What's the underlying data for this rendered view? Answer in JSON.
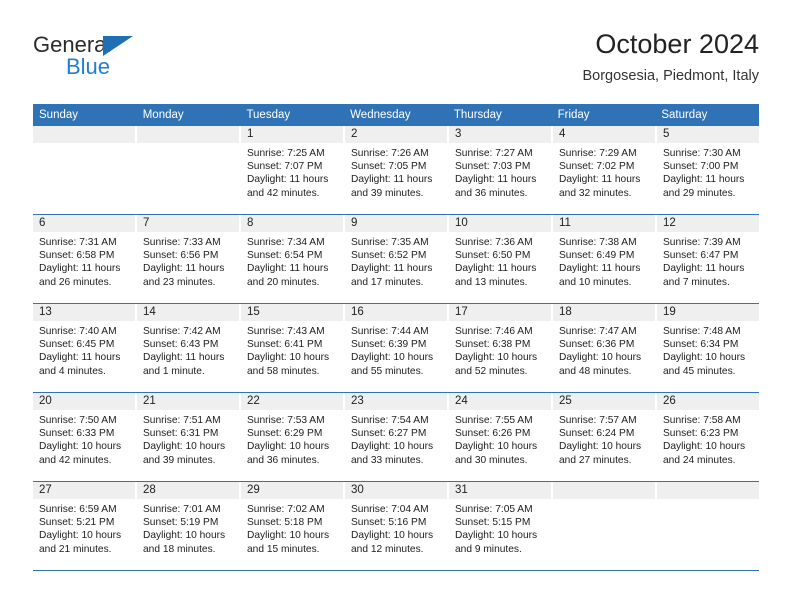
{
  "brand": {
    "name_top": "General",
    "name_bottom": "Blue",
    "triangle_color": "#1f6fb5",
    "blue_color": "#1f7fd0"
  },
  "header": {
    "title": "October 2024",
    "subtitle": "Borgosesia, Piedmont, Italy"
  },
  "theme": {
    "header_blue": "#2f73b6",
    "daynum_strip": "#efefef",
    "text": "#222222"
  },
  "weekdays": [
    "Sunday",
    "Monday",
    "Tuesday",
    "Wednesday",
    "Thursday",
    "Friday",
    "Saturday"
  ],
  "weeks": [
    [
      {
        "day": "",
        "sunrise": "",
        "sunset": "",
        "daylight1": "",
        "daylight2": "",
        "empty": true
      },
      {
        "day": "",
        "sunrise": "",
        "sunset": "",
        "daylight1": "",
        "daylight2": "",
        "empty": true
      },
      {
        "day": "1",
        "sunrise": "Sunrise: 7:25 AM",
        "sunset": "Sunset: 7:07 PM",
        "daylight1": "Daylight: 11 hours",
        "daylight2": "and 42 minutes."
      },
      {
        "day": "2",
        "sunrise": "Sunrise: 7:26 AM",
        "sunset": "Sunset: 7:05 PM",
        "daylight1": "Daylight: 11 hours",
        "daylight2": "and 39 minutes."
      },
      {
        "day": "3",
        "sunrise": "Sunrise: 7:27 AM",
        "sunset": "Sunset: 7:03 PM",
        "daylight1": "Daylight: 11 hours",
        "daylight2": "and 36 minutes."
      },
      {
        "day": "4",
        "sunrise": "Sunrise: 7:29 AM",
        "sunset": "Sunset: 7:02 PM",
        "daylight1": "Daylight: 11 hours",
        "daylight2": "and 32 minutes."
      },
      {
        "day": "5",
        "sunrise": "Sunrise: 7:30 AM",
        "sunset": "Sunset: 7:00 PM",
        "daylight1": "Daylight: 11 hours",
        "daylight2": "and 29 minutes."
      }
    ],
    [
      {
        "day": "6",
        "sunrise": "Sunrise: 7:31 AM",
        "sunset": "Sunset: 6:58 PM",
        "daylight1": "Daylight: 11 hours",
        "daylight2": "and 26 minutes."
      },
      {
        "day": "7",
        "sunrise": "Sunrise: 7:33 AM",
        "sunset": "Sunset: 6:56 PM",
        "daylight1": "Daylight: 11 hours",
        "daylight2": "and 23 minutes."
      },
      {
        "day": "8",
        "sunrise": "Sunrise: 7:34 AM",
        "sunset": "Sunset: 6:54 PM",
        "daylight1": "Daylight: 11 hours",
        "daylight2": "and 20 minutes."
      },
      {
        "day": "9",
        "sunrise": "Sunrise: 7:35 AM",
        "sunset": "Sunset: 6:52 PM",
        "daylight1": "Daylight: 11 hours",
        "daylight2": "and 17 minutes."
      },
      {
        "day": "10",
        "sunrise": "Sunrise: 7:36 AM",
        "sunset": "Sunset: 6:50 PM",
        "daylight1": "Daylight: 11 hours",
        "daylight2": "and 13 minutes."
      },
      {
        "day": "11",
        "sunrise": "Sunrise: 7:38 AM",
        "sunset": "Sunset: 6:49 PM",
        "daylight1": "Daylight: 11 hours",
        "daylight2": "and 10 minutes."
      },
      {
        "day": "12",
        "sunrise": "Sunrise: 7:39 AM",
        "sunset": "Sunset: 6:47 PM",
        "daylight1": "Daylight: 11 hours",
        "daylight2": "and 7 minutes."
      }
    ],
    [
      {
        "day": "13",
        "sunrise": "Sunrise: 7:40 AM",
        "sunset": "Sunset: 6:45 PM",
        "daylight1": "Daylight: 11 hours",
        "daylight2": "and 4 minutes."
      },
      {
        "day": "14",
        "sunrise": "Sunrise: 7:42 AM",
        "sunset": "Sunset: 6:43 PM",
        "daylight1": "Daylight: 11 hours",
        "daylight2": "and 1 minute."
      },
      {
        "day": "15",
        "sunrise": "Sunrise: 7:43 AM",
        "sunset": "Sunset: 6:41 PM",
        "daylight1": "Daylight: 10 hours",
        "daylight2": "and 58 minutes."
      },
      {
        "day": "16",
        "sunrise": "Sunrise: 7:44 AM",
        "sunset": "Sunset: 6:39 PM",
        "daylight1": "Daylight: 10 hours",
        "daylight2": "and 55 minutes."
      },
      {
        "day": "17",
        "sunrise": "Sunrise: 7:46 AM",
        "sunset": "Sunset: 6:38 PM",
        "daylight1": "Daylight: 10 hours",
        "daylight2": "and 52 minutes."
      },
      {
        "day": "18",
        "sunrise": "Sunrise: 7:47 AM",
        "sunset": "Sunset: 6:36 PM",
        "daylight1": "Daylight: 10 hours",
        "daylight2": "and 48 minutes."
      },
      {
        "day": "19",
        "sunrise": "Sunrise: 7:48 AM",
        "sunset": "Sunset: 6:34 PM",
        "daylight1": "Daylight: 10 hours",
        "daylight2": "and 45 minutes."
      }
    ],
    [
      {
        "day": "20",
        "sunrise": "Sunrise: 7:50 AM",
        "sunset": "Sunset: 6:33 PM",
        "daylight1": "Daylight: 10 hours",
        "daylight2": "and 42 minutes."
      },
      {
        "day": "21",
        "sunrise": "Sunrise: 7:51 AM",
        "sunset": "Sunset: 6:31 PM",
        "daylight1": "Daylight: 10 hours",
        "daylight2": "and 39 minutes."
      },
      {
        "day": "22",
        "sunrise": "Sunrise: 7:53 AM",
        "sunset": "Sunset: 6:29 PM",
        "daylight1": "Daylight: 10 hours",
        "daylight2": "and 36 minutes."
      },
      {
        "day": "23",
        "sunrise": "Sunrise: 7:54 AM",
        "sunset": "Sunset: 6:27 PM",
        "daylight1": "Daylight: 10 hours",
        "daylight2": "and 33 minutes."
      },
      {
        "day": "24",
        "sunrise": "Sunrise: 7:55 AM",
        "sunset": "Sunset: 6:26 PM",
        "daylight1": "Daylight: 10 hours",
        "daylight2": "and 30 minutes."
      },
      {
        "day": "25",
        "sunrise": "Sunrise: 7:57 AM",
        "sunset": "Sunset: 6:24 PM",
        "daylight1": "Daylight: 10 hours",
        "daylight2": "and 27 minutes."
      },
      {
        "day": "26",
        "sunrise": "Sunrise: 7:58 AM",
        "sunset": "Sunset: 6:23 PM",
        "daylight1": "Daylight: 10 hours",
        "daylight2": "and 24 minutes."
      }
    ],
    [
      {
        "day": "27",
        "sunrise": "Sunrise: 6:59 AM",
        "sunset": "Sunset: 5:21 PM",
        "daylight1": "Daylight: 10 hours",
        "daylight2": "and 21 minutes."
      },
      {
        "day": "28",
        "sunrise": "Sunrise: 7:01 AM",
        "sunset": "Sunset: 5:19 PM",
        "daylight1": "Daylight: 10 hours",
        "daylight2": "and 18 minutes."
      },
      {
        "day": "29",
        "sunrise": "Sunrise: 7:02 AM",
        "sunset": "Sunset: 5:18 PM",
        "daylight1": "Daylight: 10 hours",
        "daylight2": "and 15 minutes."
      },
      {
        "day": "30",
        "sunrise": "Sunrise: 7:04 AM",
        "sunset": "Sunset: 5:16 PM",
        "daylight1": "Daylight: 10 hours",
        "daylight2": "and 12 minutes."
      },
      {
        "day": "31",
        "sunrise": "Sunrise: 7:05 AM",
        "sunset": "Sunset: 5:15 PM",
        "daylight1": "Daylight: 10 hours",
        "daylight2": "and 9 minutes."
      },
      {
        "day": "",
        "sunrise": "",
        "sunset": "",
        "daylight1": "",
        "daylight2": "",
        "empty": true
      },
      {
        "day": "",
        "sunrise": "",
        "sunset": "",
        "daylight1": "",
        "daylight2": "",
        "empty": true
      }
    ]
  ]
}
